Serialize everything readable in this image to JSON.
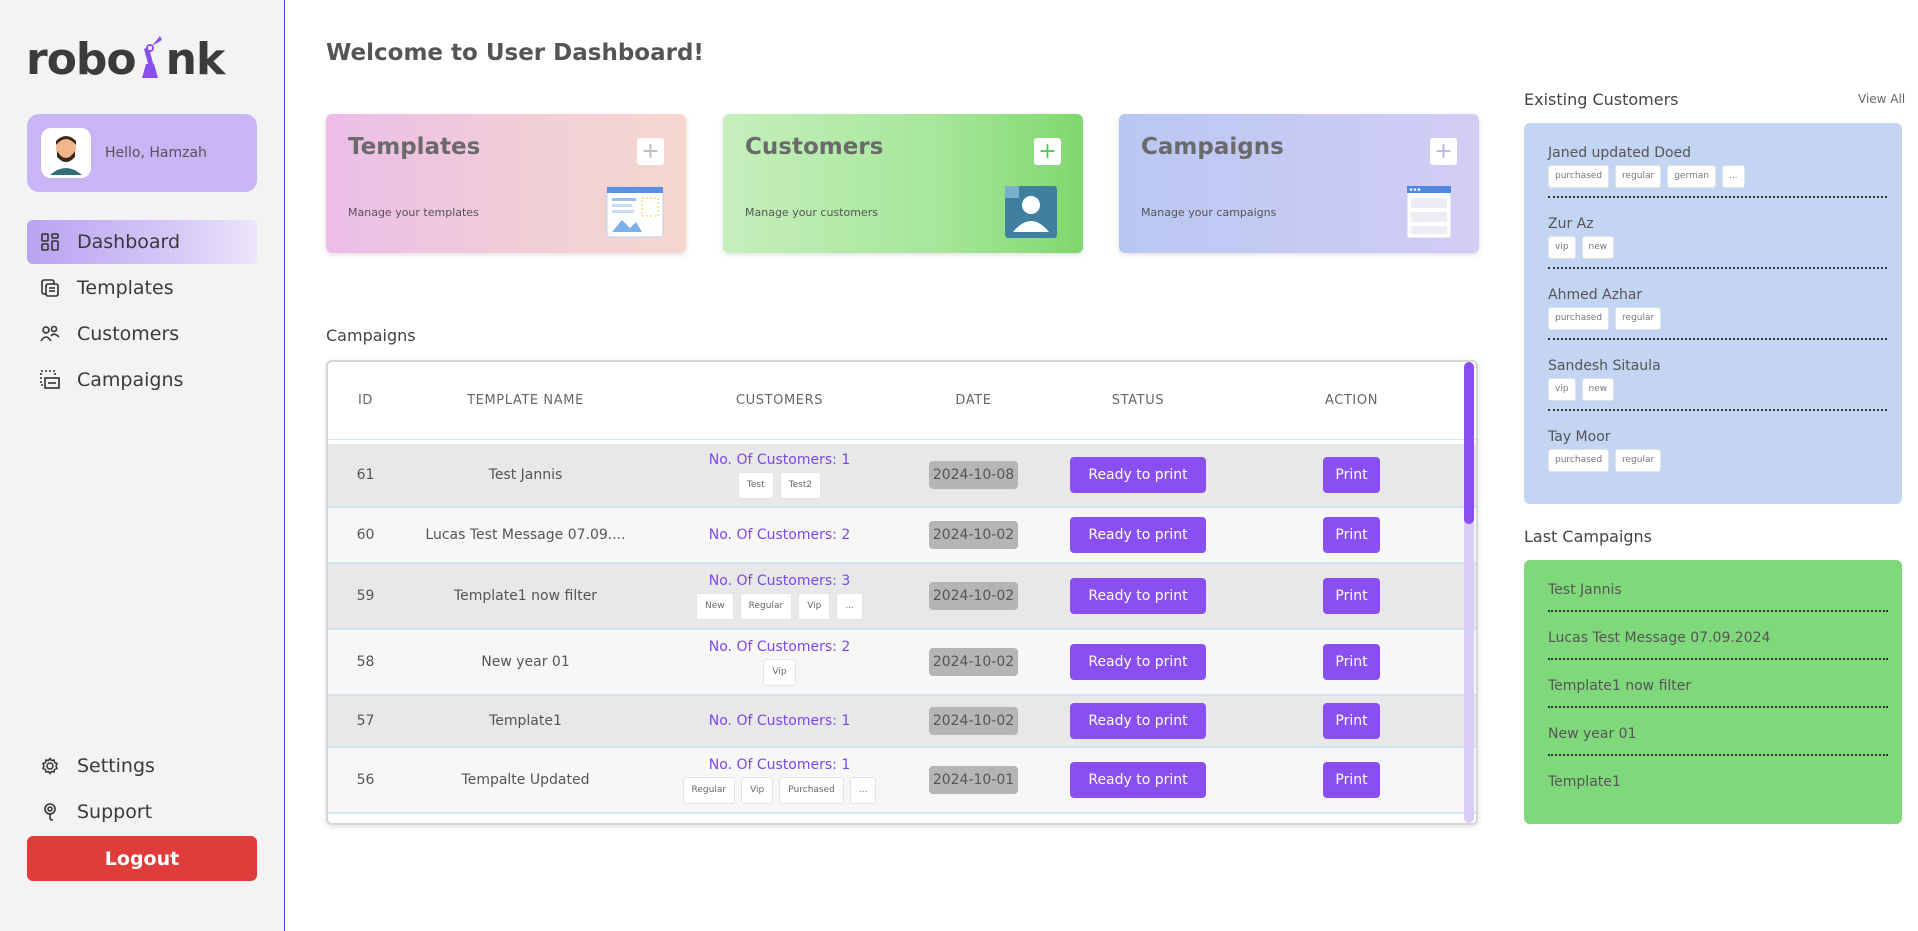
{
  "app": {
    "logo_text_1": "robo",
    "logo_text_2": "nk"
  },
  "user": {
    "greeting": "Hello, Hamzah"
  },
  "nav": {
    "items": [
      {
        "label": "Dashboard",
        "icon": "dashboard-icon",
        "active": true
      },
      {
        "label": "Templates",
        "icon": "templates-icon"
      },
      {
        "label": "Customers",
        "icon": "customers-icon"
      },
      {
        "label": "Campaigns",
        "icon": "campaigns-icon"
      }
    ],
    "bottom": [
      {
        "label": "Settings",
        "icon": "gear-icon"
      },
      {
        "label": "Support",
        "icon": "support-icon"
      }
    ],
    "logout_label": "Logout"
  },
  "main": {
    "title": "Welcome to User Dashboard!",
    "cards": [
      {
        "title": "Templates",
        "desc": "Manage your templates"
      },
      {
        "title": "Customers",
        "desc": "Manage your customers"
      },
      {
        "title": "Campaigns",
        "desc": "Manage your campaigns"
      }
    ],
    "campaigns_section_title": "Campaigns",
    "table": {
      "headers": [
        "ID",
        "TEMPLATE NAME",
        "CUSTOMERS",
        "DATE",
        "STATUS",
        "ACTION"
      ],
      "rows": [
        {
          "id": "61",
          "name": "Test Jannis",
          "customers": "No. Of Customers: 1",
          "tags": [
            "Test",
            "Test2"
          ],
          "date": "2024-10-08",
          "status": "Ready to print",
          "action": "Print"
        },
        {
          "id": "60",
          "name": "Lucas Test Message 07.09....",
          "customers": "No. Of Customers: 2",
          "tags": [],
          "date": "2024-10-02",
          "status": "Ready to print",
          "action": "Print"
        },
        {
          "id": "59",
          "name": "Template1 now filter",
          "customers": "No. Of Customers: 3",
          "tags": [
            "New",
            "Regular",
            "Vip",
            "..."
          ],
          "date": "2024-10-02",
          "status": "Ready to print",
          "action": "Print"
        },
        {
          "id": "58",
          "name": "New year 01",
          "customers": "No. Of Customers: 2",
          "tags": [
            "Vip"
          ],
          "date": "2024-10-02",
          "status": "Ready to print",
          "action": "Print"
        },
        {
          "id": "57",
          "name": "Template1",
          "customers": "No. Of Customers: 1",
          "tags": [],
          "date": "2024-10-02",
          "status": "Ready to print",
          "action": "Print"
        },
        {
          "id": "56",
          "name": "Tempalte Updated",
          "customers": "No. Of Customers: 1",
          "tags": [
            "Regular",
            "Vip",
            "Purchased",
            "..."
          ],
          "date": "2024-10-01",
          "status": "Ready to print",
          "action": "Print"
        }
      ]
    }
  },
  "existing_customers": {
    "title": "Existing Customers",
    "view_all": "View All",
    "items": [
      {
        "name": "Janed updated Doed",
        "tags": [
          "purchased",
          "regular",
          "german",
          "..."
        ]
      },
      {
        "name": "Zur Az",
        "tags": [
          "vip",
          "new"
        ]
      },
      {
        "name": "Ahmed Azhar",
        "tags": [
          "purchased",
          "regular"
        ]
      },
      {
        "name": "Sandesh Sitaula",
        "tags": [
          "vip",
          "new"
        ]
      },
      {
        "name": "Tay Moor",
        "tags": [
          "purchased",
          "regular"
        ]
      }
    ]
  },
  "last_campaigns": {
    "title": "Last Campaigns",
    "items": [
      "Test Jannis",
      "Lucas Test Message 07.09.2024",
      "Template1 now filter",
      "New year 01",
      "Template1"
    ]
  },
  "colors": {
    "accent": "#8a4ff0",
    "logout": "#e13c3c",
    "customers_panel": "#c4d4f3",
    "campaigns_panel": "#7fd97a"
  }
}
